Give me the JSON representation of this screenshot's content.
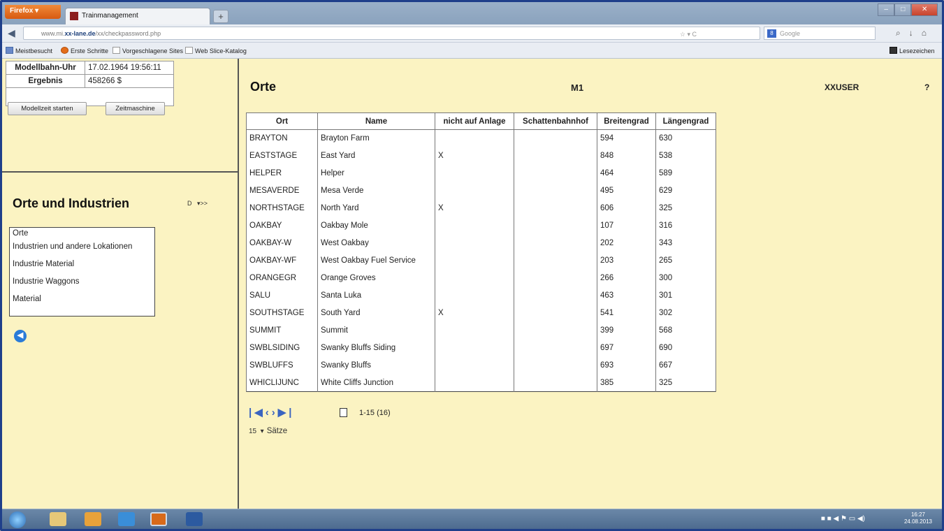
{
  "browser": {
    "menu_button": "Firefox",
    "tab_title": "Trainmanagement",
    "url_prefix": "www.mi.",
    "url_domain": "xx-lane.de",
    "url_path": "/xx/checkpassword.php",
    "search_placeholder": "Google",
    "bookmarks": [
      "Meistbesucht",
      "Erste Schritte",
      "Vorgeschlagene Sites",
      "Web Slice-Katalog"
    ],
    "bookmarks_right": "Lesezeichen"
  },
  "status": {
    "clock_label": "Modellbahn-Uhr",
    "clock_value": "17.02.1964 19:56:11",
    "result_label": "Ergebnis",
    "result_value": "458266 $",
    "start_button": "Modellzeit starten",
    "timemachine_button": "Zeitmaschine"
  },
  "sidebar": {
    "title": "Orte und Industrien",
    "lang_value": "D",
    "go_label": ">>",
    "items": [
      "Orte",
      "Industrien und andere Lokationen",
      "Industrie Material",
      "Industrie Waggons",
      "Material"
    ]
  },
  "header": {
    "title": "Orte",
    "layout": "M1",
    "user": "XXUSER",
    "help": "?"
  },
  "table": {
    "columns": [
      "Ort",
      "Name",
      "nicht auf Anlage",
      "Schattenbahnhof",
      "Breitengrad",
      "Längengrad"
    ],
    "rows": [
      [
        "BRAYTON",
        "Brayton Farm",
        "",
        "",
        "594",
        "630"
      ],
      [
        "EASTSTAGE",
        "East Yard",
        "X",
        "",
        "848",
        "538"
      ],
      [
        "HELPER",
        "Helper",
        "",
        "",
        "464",
        "589"
      ],
      [
        "MESAVERDE",
        "Mesa Verde",
        "",
        "",
        "495",
        "629"
      ],
      [
        "NORTHSTAGE",
        "North Yard",
        "X",
        "",
        "606",
        "325"
      ],
      [
        "OAKBAY",
        "Oakbay Mole",
        "",
        "",
        "107",
        "316"
      ],
      [
        "OAKBAY-W",
        "West Oakbay",
        "",
        "",
        "202",
        "343"
      ],
      [
        "OAKBAY-WF",
        "West Oakbay Fuel Service",
        "",
        "",
        "203",
        "265"
      ],
      [
        "ORANGEGR",
        "Orange Groves",
        "",
        "",
        "266",
        "300"
      ],
      [
        "SALU",
        "Santa Luka",
        "",
        "",
        "463",
        "301"
      ],
      [
        "SOUTHSTAGE",
        "South Yard",
        "X",
        "",
        "541",
        "302"
      ],
      [
        "SUMMIT",
        "Summit",
        "",
        "",
        "399",
        "568"
      ],
      [
        "SWBLSIDING",
        "Swanky Bluffs Siding",
        "",
        "",
        "697",
        "690"
      ],
      [
        "SWBLUFFS",
        "Swanky Bluffs",
        "",
        "",
        "693",
        "667"
      ],
      [
        "WHICLIJUNC",
        "White Cliffs Junction",
        "",
        "",
        "385",
        "325"
      ]
    ]
  },
  "pagination": {
    "range": "1-15 (16)",
    "page_size": "15",
    "page_size_label": "Sätze"
  },
  "taskbar": {
    "time": "16:27",
    "date": "24.08.2013"
  }
}
